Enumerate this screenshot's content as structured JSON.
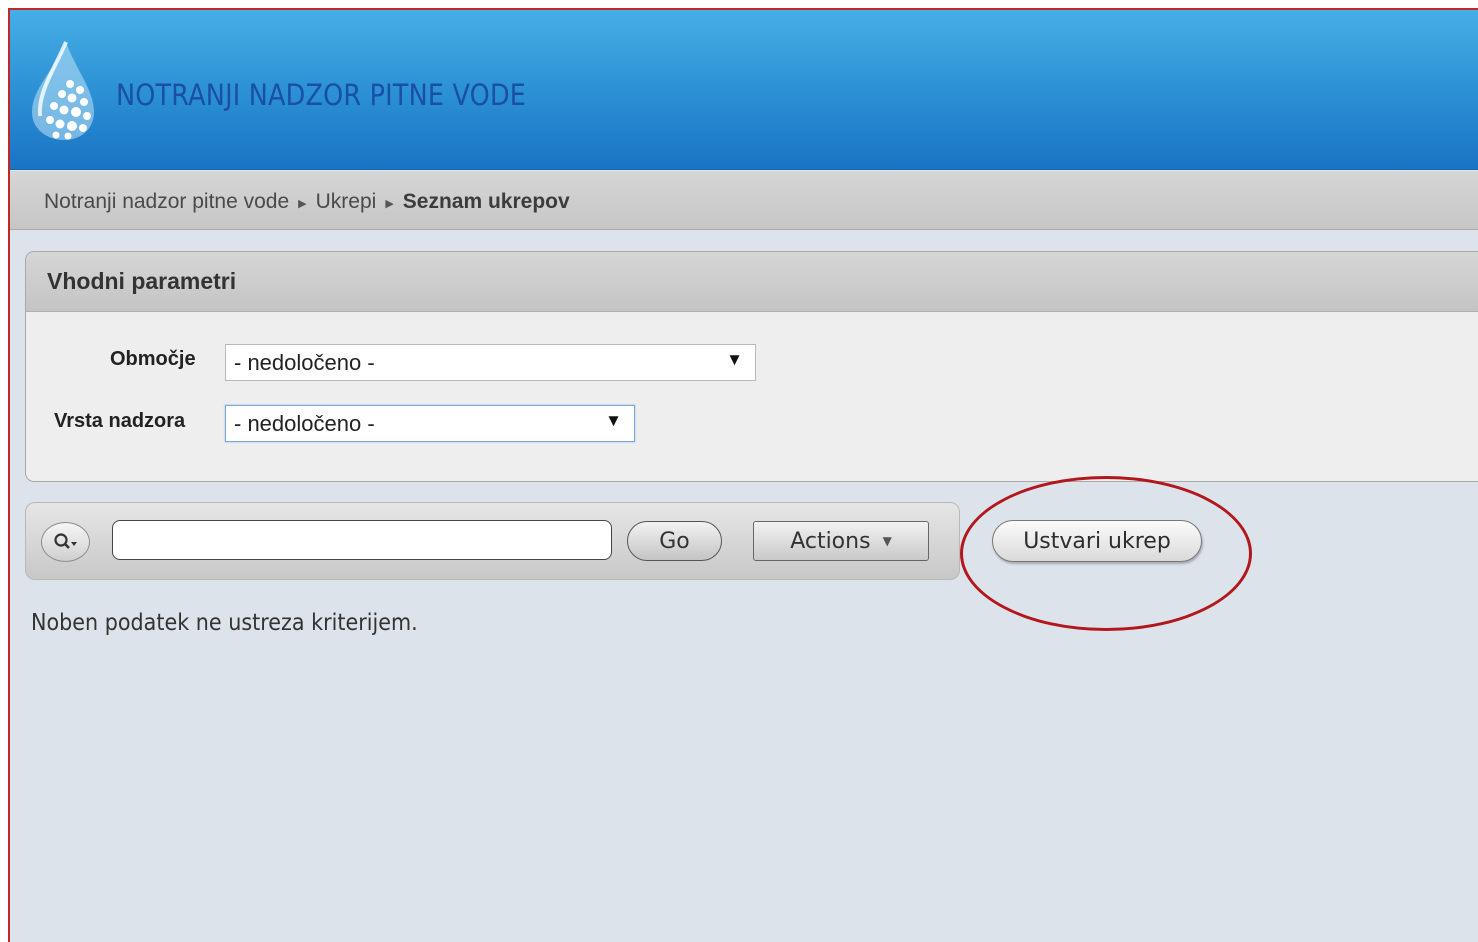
{
  "header": {
    "app_title": "NOTRANJI NADZOR PITNE VODE"
  },
  "breadcrumb": {
    "items": [
      "Notranji nadzor pitne vode",
      "Ukrepi"
    ],
    "current": "Seznam ukrepov"
  },
  "params_region": {
    "title": "Vhodni parametri",
    "fields": [
      {
        "label": "Območje",
        "value": "- nedoločeno -"
      },
      {
        "label": "Vrsta nadzora",
        "value": "- nedoločeno -"
      }
    ]
  },
  "toolbar": {
    "search_value": "",
    "go_label": "Go",
    "actions_label": "Actions"
  },
  "create_button_label": "Ustvari ukrep",
  "empty_message": "Noben podatek ne ustreza kriterijem.",
  "colors": {
    "header_blue": "#2a8fd3",
    "title_blue": "#1a4fa6",
    "highlight_red": "#b3161b"
  }
}
